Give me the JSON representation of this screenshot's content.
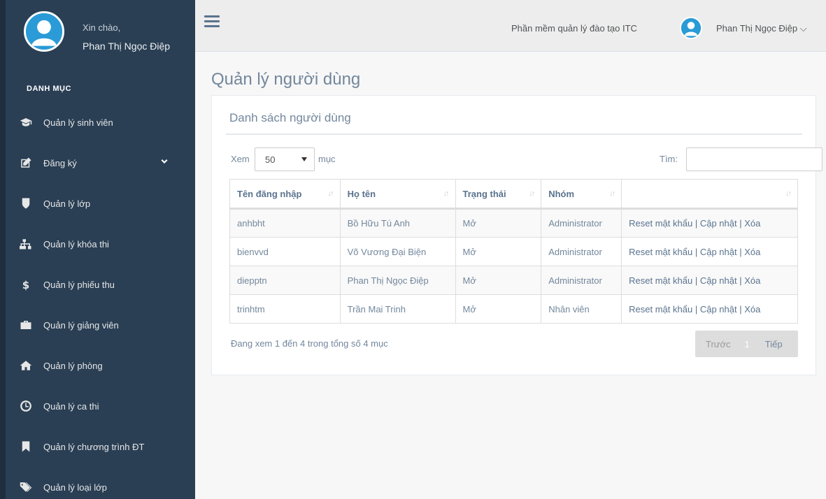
{
  "sidebar": {
    "greeting": "Xin chào,",
    "user_name": "Phan Thị Ngọc Điệp",
    "section_title": "DANH MỤC",
    "items": [
      {
        "label": "Quản lý sinh viên",
        "icon": "graduation-cap-icon"
      },
      {
        "label": "Đăng ký",
        "icon": "edit-icon",
        "has_submenu": true
      },
      {
        "label": "Quản lý lớp",
        "icon": "shield-icon"
      },
      {
        "label": "Quản lý khóa thi",
        "icon": "sitemap-icon"
      },
      {
        "label": "Quản lý phiếu thu",
        "icon": "dollar-icon"
      },
      {
        "label": "Quản lý giảng viên",
        "icon": "briefcase-icon"
      },
      {
        "label": "Quản lý phòng",
        "icon": "home-icon"
      },
      {
        "label": "Quản lý ca thi",
        "icon": "clock-icon"
      },
      {
        "label": "Quản lý chương trình ĐT",
        "icon": "bookmark-icon"
      },
      {
        "label": "Quản lý loại lớp",
        "icon": "tags-icon"
      }
    ]
  },
  "topnav": {
    "app_name": "Phần mềm quản lý đào tạo ITC",
    "user_name": "Phan Thị Ngọc Điệp ⌵"
  },
  "page": {
    "title": "Quản lý người dùng"
  },
  "panel": {
    "title": "Danh sách người dùng",
    "length_label": "Xem",
    "length_value": "50",
    "length_suffix": "mục",
    "search_label": "Tìm:",
    "search_value": "",
    "columns": [
      "Tên đăng nhập",
      "Họ tên",
      "Trạng thái",
      "Nhóm",
      ""
    ],
    "rows": [
      {
        "username": "anhbht",
        "fullname": "Bồ Hữu Tú Anh",
        "status": "Mở",
        "group": "Administrator"
      },
      {
        "username": "bienvvd",
        "fullname": "Võ Vương Đại Biện",
        "status": "Mở",
        "group": "Administrator"
      },
      {
        "username": "diepptn",
        "fullname": "Phan Thị Ngọc Điệp",
        "status": "Mở",
        "group": "Administrator"
      },
      {
        "username": "trinhtm",
        "fullname": "Trần Mai Trinh",
        "status": "Mở",
        "group": "Nhân viên"
      }
    ],
    "actions": {
      "reset": "Reset mật khẩu",
      "update": "Cập nhật",
      "delete": "Xóa",
      "separator": "|"
    },
    "info": "Đang xem 1 đến 4 trong tổng số 4 mục",
    "pager": {
      "prev": "Trước",
      "current": "1",
      "next": "Tiếp"
    }
  },
  "colors": {
    "sidebar_bg": "#2a3f54",
    "topnav_bg": "#ededed",
    "accent_blue": "#2a9bd6",
    "text": "#73879c"
  }
}
